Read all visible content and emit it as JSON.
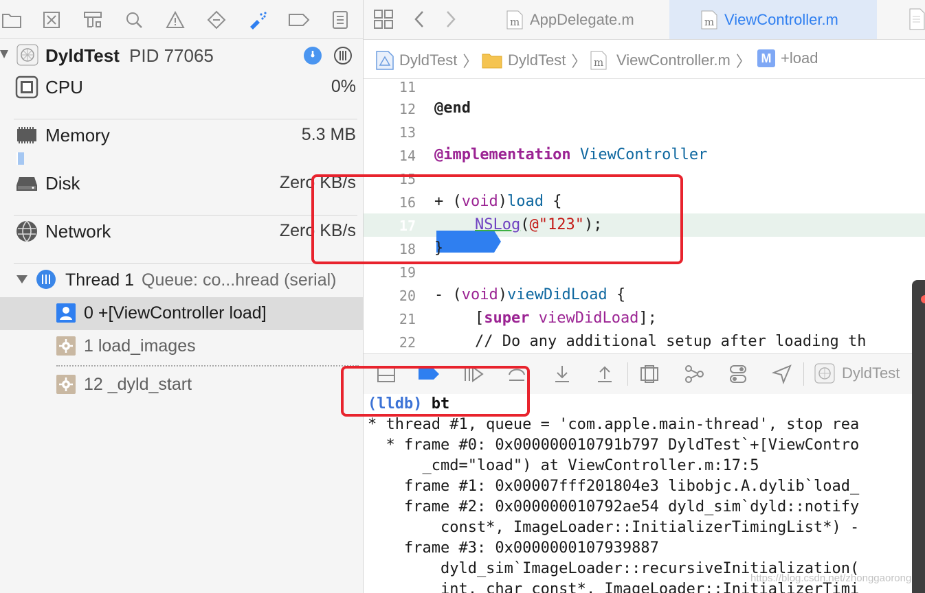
{
  "navigator": {
    "process": {
      "name": "DyldTest",
      "pid_label": "PID 77065"
    },
    "gauges": [
      {
        "label": "CPU",
        "value": "0%",
        "icon": "cpu-icon"
      },
      {
        "label": "Memory",
        "value": "5.3 MB",
        "icon": "memory-icon"
      },
      {
        "label": "Disk",
        "value": "Zero KB/s",
        "icon": "disk-icon"
      },
      {
        "label": "Network",
        "value": "Zero KB/s",
        "icon": "network-icon"
      }
    ],
    "thread": {
      "name": "Thread 1",
      "queue": "Queue: co...hread (serial)"
    },
    "frames": [
      {
        "label": "0 +[ViewController load]",
        "icon": "user-frame-icon"
      },
      {
        "label": "1 load_images",
        "icon": "system-frame-icon"
      },
      {
        "label": "12 _dyld_start",
        "icon": "system-frame-icon"
      }
    ]
  },
  "tabs": [
    {
      "label": "AppDelegate.m",
      "active": false
    },
    {
      "label": "ViewController.m",
      "active": true
    }
  ],
  "jumpbar": {
    "items": [
      "DyldTest",
      "DyldTest",
      "ViewController.m",
      "+load"
    ],
    "method_badge": "M"
  },
  "editor": {
    "line_numbers": [
      "11",
      "12",
      "13",
      "14",
      "15",
      "16",
      "17",
      "18",
      "19",
      "20",
      "21",
      "22"
    ],
    "current_line": "17",
    "code": {
      "l12": "@end",
      "l14_kw": "@implementation",
      "l14_cls": "ViewController",
      "l16_a": "+ (",
      "l16_type": "void",
      "l16_b": ")",
      "l16_fn": "load",
      "l16_c": " {",
      "l17_fn": "NSLog",
      "l17_a": "(",
      "l17_str": "@\"123\"",
      "l17_b": ");",
      "l18": "}",
      "l20_a": "- (",
      "l20_type": "void",
      "l20_b": ")",
      "l20_fn": "viewDidLoad",
      "l20_c": " {",
      "l21_a": "[",
      "l21_kw": "super",
      "l21_fn": "viewDidLoad",
      "l21_b": "];",
      "l22": "// Do any additional setup after loading th"
    }
  },
  "debugbar": {
    "target": "DyldTest"
  },
  "console": {
    "prompt": "(lldb)",
    "command": "bt",
    "lines": [
      "* thread #1, queue = 'com.apple.main-thread', stop rea",
      "  * frame #0: 0x000000010791b797 DyldTest`+[ViewContro",
      "      _cmd=\"load\") at ViewController.m:17:5",
      "    frame #1: 0x00007fff201804e3 libobjc.A.dylib`load_",
      "    frame #2: 0x000000010792ae54 dyld_sim`dyld::notify",
      "        const*, ImageLoader::InitializerTimingList*) -",
      "    frame #3: 0x0000000107939887",
      "        dyld_sim`ImageLoader::recursiveInitialization(",
      "        int, char const*, ImageLoader::InitializerTimi"
    ],
    "watermark": "https://blog.csdn.net/zhonggaorong"
  },
  "colors": {
    "accent": "#2f7ff0",
    "highlight": "#e8f2ec",
    "annotation": "#e8232d"
  }
}
